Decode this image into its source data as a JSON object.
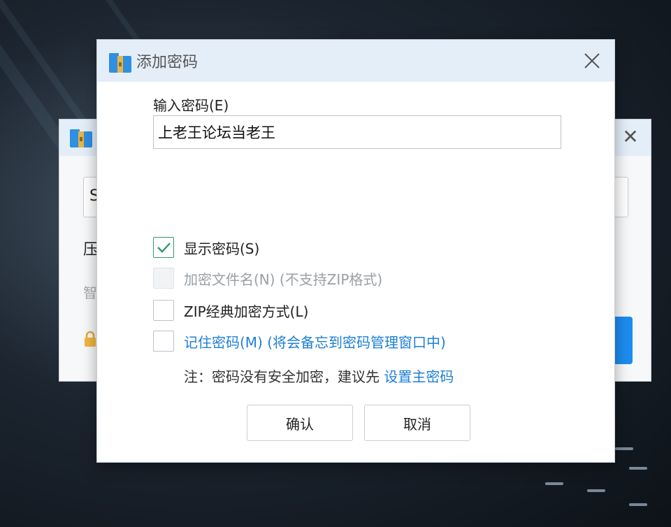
{
  "dialog": {
    "title": "添加密码",
    "password_label": "输入密码(E)",
    "password_value": "上老王论坛当老王",
    "options": [
      {
        "label": "显示密码(S)",
        "checked": true,
        "disabled": false
      },
      {
        "label": "加密文件名(N) (不支持ZIP格式)",
        "checked": false,
        "disabled": true
      },
      {
        "label": "ZIP经典加密方式(L)",
        "checked": false,
        "disabled": false
      },
      {
        "label": "记住密码(M) (将会备忘到密码管理窗口中)",
        "checked": false,
        "disabled": false
      }
    ],
    "note_prefix": "注：密码没有安全加密，建议先",
    "note_link": "设置主密码",
    "confirm_label": "确认",
    "cancel_label": "取消"
  },
  "background_window": {
    "input_partial": "S",
    "label_partial": "压",
    "hint_partial": "智"
  },
  "colors": {
    "titlebar": "#e4eef9",
    "link": "#1d7fd6",
    "check": "#2e9a66",
    "accent_button": "#1c8cf0"
  },
  "icons": {
    "app": "archive-folder-icon",
    "close": "close-icon",
    "check": "checkmark-icon",
    "lock": "lock-icon"
  }
}
